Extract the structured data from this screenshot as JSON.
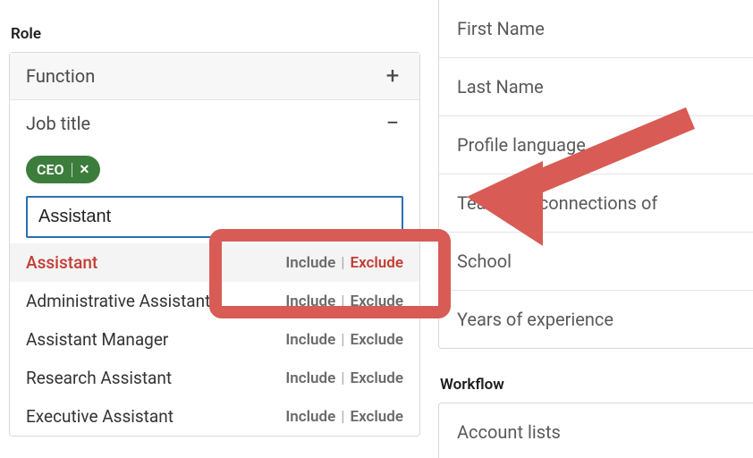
{
  "left": {
    "section_label": "Role",
    "function": {
      "label": "Function",
      "icon": "+"
    },
    "job_title": {
      "label": "Job title",
      "icon": "−",
      "chip_text": "CEO",
      "chip_x": "✕",
      "input_value": "Assistant",
      "include_label": "Include",
      "exclude_label": "Exclude",
      "suggestions": [
        {
          "label": "Assistant",
          "active": true
        },
        {
          "label": "Administrative Assistant",
          "active": false
        },
        {
          "label": "Assistant Manager",
          "active": false
        },
        {
          "label": "Research Assistant",
          "active": false
        },
        {
          "label": "Executive Assistant",
          "active": false
        }
      ]
    }
  },
  "right": {
    "items": [
      "First Name",
      "Last Name",
      "Profile language",
      "TeamLink connections of",
      "School",
      "Years of experience"
    ],
    "workflow_label": "Workflow",
    "workflow_items": [
      "Account lists"
    ]
  }
}
